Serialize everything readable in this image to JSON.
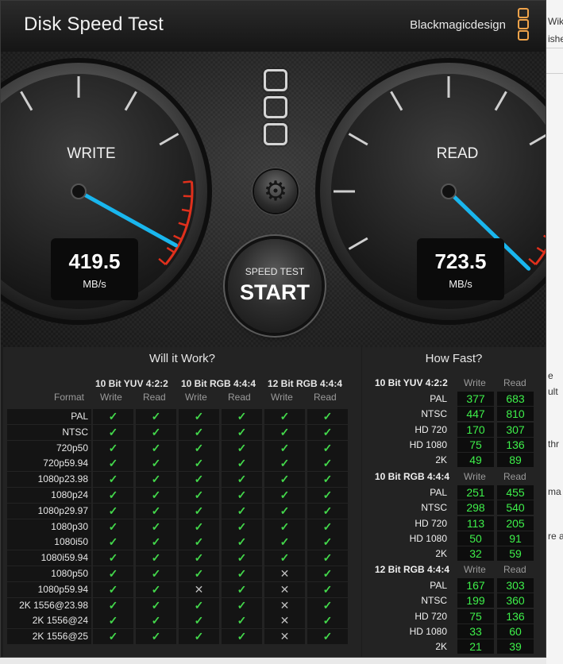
{
  "window": {
    "title": "Disk Speed Test",
    "brand": "Blackmagicdesign",
    "accent": "#f0a34a"
  },
  "gauges": {
    "write": {
      "label": "WRITE",
      "value": "419.5",
      "unit": "MB/s"
    },
    "read": {
      "label": "READ",
      "value": "723.5",
      "unit": "MB/s"
    },
    "needle_color": "#19b6ee",
    "redzone_color": "#e0301c"
  },
  "start_button": {
    "small_label": "SPEED TEST",
    "big_label": "START"
  },
  "settings_icon": "gear-icon",
  "will_it_work": {
    "title": "Will it Work?",
    "format_header": "Format",
    "groups": [
      "10 Bit YUV 4:2:2",
      "10 Bit RGB 4:4:4",
      "12 Bit RGB 4:4:4"
    ],
    "subheaders": [
      "Write",
      "Read",
      "Write",
      "Read",
      "Write",
      "Read"
    ],
    "rows": [
      {
        "format": "PAL",
        "cells": [
          1,
          1,
          1,
          1,
          1,
          1
        ]
      },
      {
        "format": "NTSC",
        "cells": [
          1,
          1,
          1,
          1,
          1,
          1
        ]
      },
      {
        "format": "720p50",
        "cells": [
          1,
          1,
          1,
          1,
          1,
          1
        ]
      },
      {
        "format": "720p59.94",
        "cells": [
          1,
          1,
          1,
          1,
          1,
          1
        ]
      },
      {
        "format": "1080p23.98",
        "cells": [
          1,
          1,
          1,
          1,
          1,
          1
        ]
      },
      {
        "format": "1080p24",
        "cells": [
          1,
          1,
          1,
          1,
          1,
          1
        ]
      },
      {
        "format": "1080p29.97",
        "cells": [
          1,
          1,
          1,
          1,
          1,
          1
        ]
      },
      {
        "format": "1080p30",
        "cells": [
          1,
          1,
          1,
          1,
          1,
          1
        ]
      },
      {
        "format": "1080i50",
        "cells": [
          1,
          1,
          1,
          1,
          1,
          1
        ]
      },
      {
        "format": "1080i59.94",
        "cells": [
          1,
          1,
          1,
          1,
          1,
          1
        ]
      },
      {
        "format": "1080p50",
        "cells": [
          1,
          1,
          1,
          1,
          0,
          1
        ]
      },
      {
        "format": "1080p59.94",
        "cells": [
          1,
          1,
          0,
          1,
          0,
          1
        ]
      },
      {
        "format": "2K 1556@23.98",
        "cells": [
          1,
          1,
          1,
          1,
          0,
          1
        ]
      },
      {
        "format": "2K 1556@24",
        "cells": [
          1,
          1,
          1,
          1,
          0,
          1
        ]
      },
      {
        "format": "2K 1556@25",
        "cells": [
          1,
          1,
          1,
          1,
          0,
          1
        ]
      }
    ],
    "check_symbol": "✓",
    "cross_symbol": "✕"
  },
  "how_fast": {
    "title": "How Fast?",
    "col_write": "Write",
    "col_read": "Read",
    "groups": [
      {
        "name": "10 Bit YUV 4:2:2",
        "rows": [
          {
            "label": "PAL",
            "write": "377",
            "read": "683"
          },
          {
            "label": "NTSC",
            "write": "447",
            "read": "810"
          },
          {
            "label": "HD 720",
            "write": "170",
            "read": "307"
          },
          {
            "label": "HD 1080",
            "write": "75",
            "read": "136"
          },
          {
            "label": "2K",
            "write": "49",
            "read": "89"
          }
        ]
      },
      {
        "name": "10 Bit RGB 4:4:4",
        "rows": [
          {
            "label": "PAL",
            "write": "251",
            "read": "455"
          },
          {
            "label": "NTSC",
            "write": "298",
            "read": "540"
          },
          {
            "label": "HD 720",
            "write": "113",
            "read": "205"
          },
          {
            "label": "HD 1080",
            "write": "50",
            "read": "91"
          },
          {
            "label": "2K",
            "write": "32",
            "read": "59"
          }
        ]
      },
      {
        "name": "12 Bit RGB 4:4:4",
        "rows": [
          {
            "label": "PAL",
            "write": "167",
            "read": "303"
          },
          {
            "label": "NTSC",
            "write": "199",
            "read": "360"
          },
          {
            "label": "HD 720",
            "write": "75",
            "read": "136"
          },
          {
            "label": "HD 1080",
            "write": "33",
            "read": "60"
          },
          {
            "label": "2K",
            "write": "21",
            "read": "39"
          }
        ]
      }
    ]
  },
  "background_page": {
    "snippets": [
      "Wik",
      "ishe",
      "e",
      "ult",
      "thr",
      "ma",
      "re a"
    ]
  }
}
